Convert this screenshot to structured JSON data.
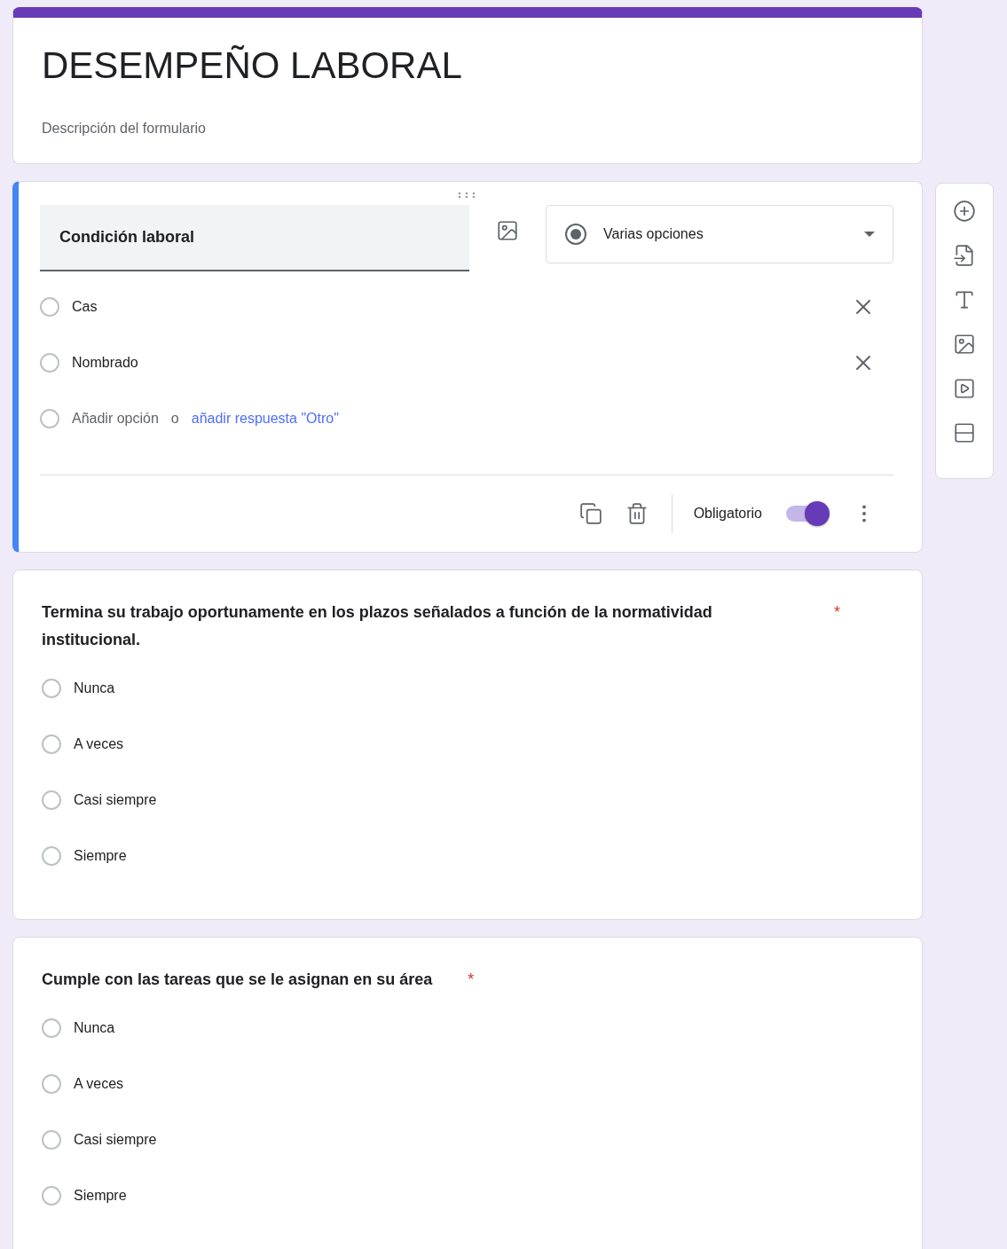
{
  "form": {
    "title": "DESEMPEÑO LABORAL",
    "description": "Descripción del formulario"
  },
  "editing_question": {
    "title": "Condición laboral",
    "type_selector": "Varias opciones",
    "options": [
      {
        "label": "Cas",
        "selected": false
      },
      {
        "label": "Nombrado",
        "selected": false
      }
    ],
    "add_row": {
      "selected": false,
      "add_option": "Añadir opción",
      "add_separator": "o",
      "add_other": "añadir respuesta \"Otro\""
    },
    "required_label": "Obligatorio",
    "required": true
  },
  "questions": [
    {
      "text": "Termina su trabajo oportunamente en los plazos señalados a función de la normatividad institucional.",
      "required_mark": "*",
      "options": [
        {
          "label": "Nunca",
          "selected": false
        },
        {
          "label": "A veces",
          "selected": false
        },
        {
          "label": "Casi siempre",
          "selected": false
        },
        {
          "label": "Siempre",
          "selected": false
        }
      ]
    },
    {
      "text": "Cumple con las tareas que se le asignan en su área",
      "required_mark": "*",
      "options": [
        {
          "label": "Nunca",
          "selected": false
        },
        {
          "label": "A veces",
          "selected": false
        },
        {
          "label": "Casi siempre",
          "selected": false
        },
        {
          "label": "Siempre",
          "selected": false
        }
      ]
    }
  ]
}
